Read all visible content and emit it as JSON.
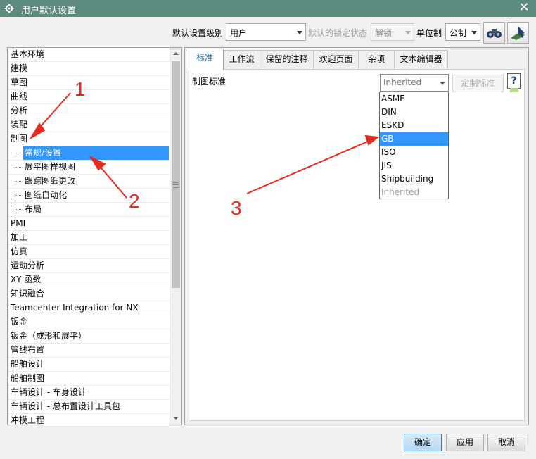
{
  "window": {
    "title": "用户默认设置",
    "close_glyph": "✕"
  },
  "toolbar": {
    "level_label": "默认设置级别",
    "level_value": "用户",
    "lock_label": "默认的锁定状态",
    "lock_value": "解锁",
    "unit_label": "单位制",
    "unit_value": "公制",
    "icons": [
      "binoculars-icon",
      "settings-pointer-icon"
    ]
  },
  "tree": {
    "items": [
      {
        "label": "基本环境",
        "level": 0
      },
      {
        "label": "建模",
        "level": 0
      },
      {
        "label": "草图",
        "level": 0
      },
      {
        "label": "曲线",
        "level": 0
      },
      {
        "label": "分析",
        "level": 0
      },
      {
        "label": "装配",
        "level": 0
      },
      {
        "label": "制图",
        "level": 0
      },
      {
        "label": "常规/设置",
        "level": 1,
        "selected": true
      },
      {
        "label": "展平图样视图",
        "level": 1
      },
      {
        "label": "跟踪图纸更改",
        "level": 1
      },
      {
        "label": "图纸自动化",
        "level": 1
      },
      {
        "label": "布局",
        "level": 1
      },
      {
        "label": "PMI",
        "level": 0
      },
      {
        "label": "加工",
        "level": 0
      },
      {
        "label": "仿真",
        "level": 0
      },
      {
        "label": "运动分析",
        "level": 0
      },
      {
        "label": "XY 函数",
        "level": 0
      },
      {
        "label": "知识融合",
        "level": 0
      },
      {
        "label": "Teamcenter Integration for NX",
        "level": 0
      },
      {
        "label": "钣金",
        "level": 0
      },
      {
        "label": "钣金（成形和展平）",
        "level": 0
      },
      {
        "label": "管线布置",
        "level": 0
      },
      {
        "label": "船舶设计",
        "level": 0
      },
      {
        "label": "船舶制图",
        "level": 0
      },
      {
        "label": "车辆设计 - 车身设计",
        "level": 0
      },
      {
        "label": "车辆设计 - 总布置设计工具包",
        "level": 0
      },
      {
        "label": "冲模工程",
        "level": 0
      }
    ]
  },
  "tabs": [
    {
      "label": "标准",
      "active": true
    },
    {
      "label": "工作流"
    },
    {
      "label": "保留的注释"
    },
    {
      "label": "欢迎页面"
    },
    {
      "label": "杂项"
    },
    {
      "label": "文本编辑器"
    }
  ],
  "standard": {
    "label": "制图标准",
    "value": "Inherited",
    "custom_button": "定制标准",
    "help_glyph": "?",
    "options": [
      {
        "label": "ASME"
      },
      {
        "label": "DIN"
      },
      {
        "label": "ESKD"
      },
      {
        "label": "GB",
        "highlighted": true
      },
      {
        "label": "ISO"
      },
      {
        "label": "JIS"
      },
      {
        "label": "Shipbuilding"
      },
      {
        "label": "Inherited",
        "disabled": true
      }
    ]
  },
  "footer": {
    "ok": "确定",
    "apply": "应用",
    "cancel": "取消"
  },
  "annotations": {
    "color": "#e82b1f",
    "labels": [
      "1",
      "2",
      "3"
    ]
  }
}
